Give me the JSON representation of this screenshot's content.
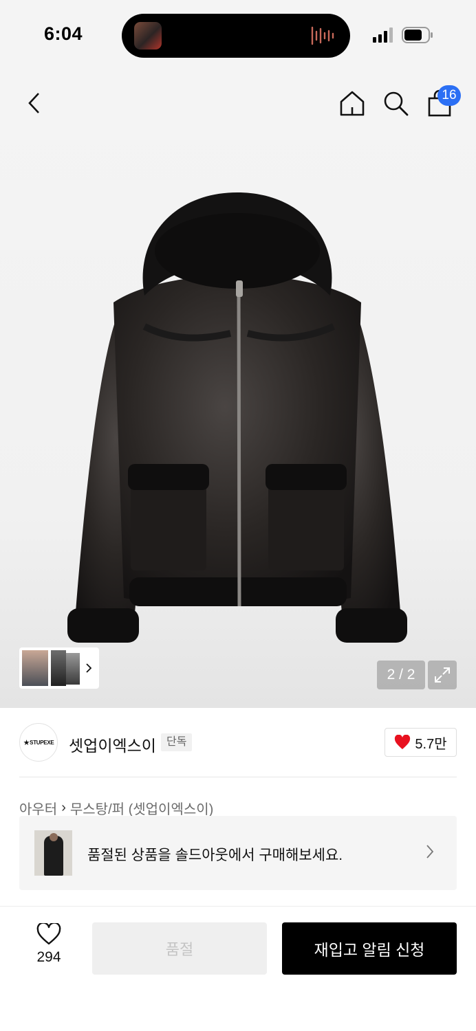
{
  "status_bar": {
    "time": "6:04"
  },
  "header": {
    "cart_count": "16"
  },
  "gallery": {
    "counter": "2 / 2"
  },
  "brand": {
    "logo_text": "STUPEXE",
    "name": "셋업이엑스이",
    "tag": "단독",
    "likes": "5.7만"
  },
  "category": {
    "parent": "아우터",
    "separator": "›",
    "child": "무스탕/퍼 (셋업이엑스이)"
  },
  "promo": {
    "text": "품절된 상품을 솔드아웃에서 구매해보세요."
  },
  "bottom_bar": {
    "wish_count": "294",
    "soldout_label": "품절",
    "restock_label": "재입고 알림 신청"
  },
  "colors": {
    "accent_blue": "#2b6ff4",
    "heart_red": "#e8111f",
    "button_black": "#000000"
  }
}
